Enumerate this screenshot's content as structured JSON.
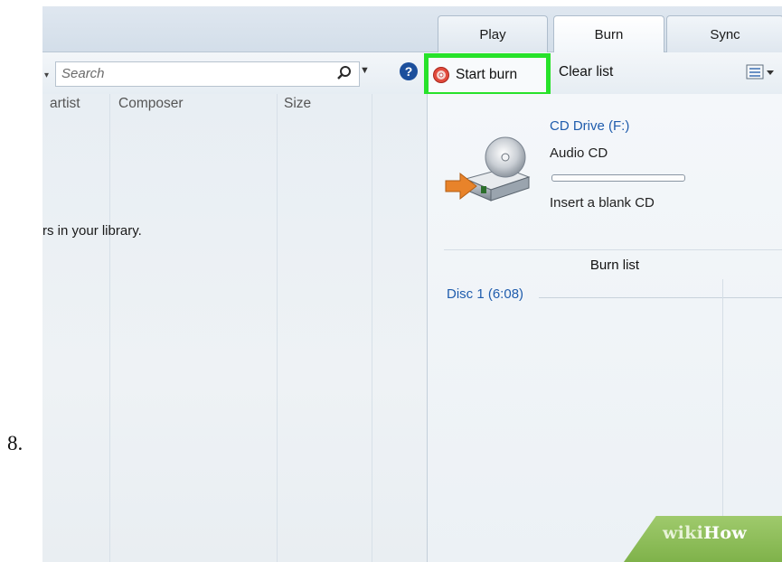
{
  "step_number": "8.",
  "tabs": [
    {
      "label": "Play"
    },
    {
      "label": "Burn"
    },
    {
      "label": "Sync"
    }
  ],
  "toolbar": {
    "search_placeholder": "Search",
    "start_burn_label": "Start burn",
    "clear_list_label": "Clear list",
    "highlight_color": "#27e22a"
  },
  "columns": [
    {
      "label": "artist"
    },
    {
      "label": "Composer"
    },
    {
      "label": "Size"
    }
  ],
  "library_message": "rs in your library.",
  "drive": {
    "name": "CD Drive (F:)",
    "type": "Audio CD",
    "status": "Insert a blank CD",
    "progress": 0
  },
  "burn_list": {
    "title": "Burn list",
    "disc_label": "Disc 1 (6:08)"
  },
  "watermark": {
    "part1": "wiki",
    "part2": "How"
  },
  "colors": {
    "link_blue": "#1f5cad",
    "help_blue": "#1c4f9c",
    "wiki_green": "#8cbd58"
  }
}
